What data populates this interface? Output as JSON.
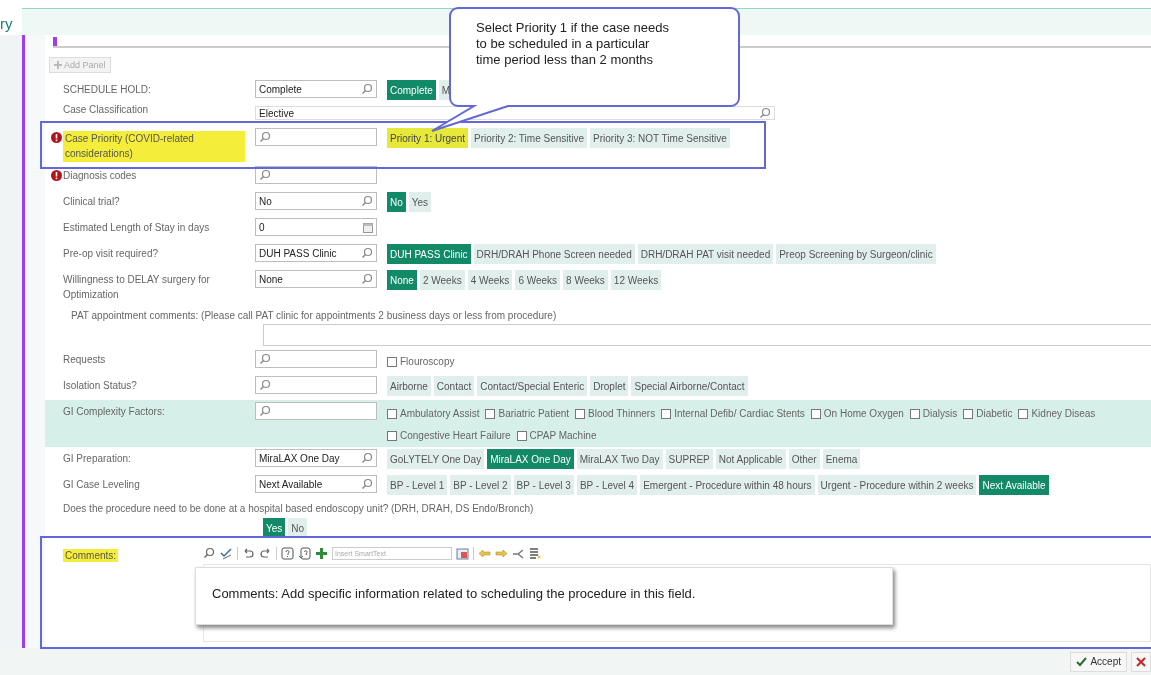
{
  "header": {
    "title": "ry"
  },
  "add_panel": {
    "label": "Add Panel",
    "disabled": true
  },
  "form_rows": [
    {
      "kind": "choice",
      "label": "SCHEDULE HOLD:",
      "value": "Complete",
      "options": [
        {
          "label": "Complete",
          "selected": true
        },
        {
          "label": "M",
          "selected": false
        }
      ]
    },
    {
      "kind": "text",
      "label": "Case Classification",
      "value": "Elective"
    },
    {
      "kind": "choice",
      "label": "Case Priority (COVID-related considerations)",
      "required": true,
      "highlighted": true,
      "value": "",
      "options": [
        {
          "label": "Priority 1: Urgent",
          "selected": false,
          "highlighted": true
        },
        {
          "label": "Priority 2: Time Sensitive",
          "selected": false,
          "highlighted": false
        },
        {
          "label": "Priority 3: NOT Time Sensitive",
          "selected": false,
          "highlighted": false
        }
      ]
    },
    {
      "kind": "choice",
      "label": "Diagnosis codes",
      "required": true,
      "value": "",
      "options": []
    },
    {
      "kind": "choice",
      "label": "Clinical trial?",
      "value": "No",
      "options": [
        {
          "label": "No",
          "selected": true
        },
        {
          "label": "Yes",
          "selected": false
        }
      ]
    },
    {
      "kind": "number",
      "label": "Estimated Length of Stay in days",
      "value": "0"
    },
    {
      "kind": "choice",
      "label": "Pre-op visit required?",
      "value": "DUH PASS Clinic",
      "options": [
        {
          "label": "DUH PASS Clinic",
          "selected": true
        },
        {
          "label": "DRH/DRAH Phone Screen needed",
          "selected": false
        },
        {
          "label": "DRH/DRAH PAT visit needed",
          "selected": false
        },
        {
          "label": "Preop Screening by Surgeon/clinic",
          "selected": false
        }
      ]
    },
    {
      "kind": "choice",
      "label": "Willingness to DELAY surgery for Optimization",
      "value": "None",
      "options": [
        {
          "label": "None",
          "selected": true
        },
        {
          "label": "2 Weeks",
          "selected": false
        },
        {
          "label": "4 Weeks",
          "selected": false
        },
        {
          "label": "6 Weeks",
          "selected": false
        },
        {
          "label": "8 Weeks",
          "selected": false
        },
        {
          "label": "12 Weeks",
          "selected": false
        }
      ]
    },
    {
      "kind": "note",
      "label": "PAT appointment comments: (Please call PAT clinic for appointments 2 business days or less from procedure)"
    },
    {
      "kind": "checks",
      "label": "Requests",
      "value": "",
      "options": [
        {
          "label": "Flouroscopy",
          "checked": false
        }
      ]
    },
    {
      "kind": "choice",
      "label": "Isolation Status?",
      "value": "",
      "options": [
        {
          "label": "Airborne",
          "selected": false
        },
        {
          "label": "Contact",
          "selected": false
        },
        {
          "label": "Contact/Special Enteric",
          "selected": false
        },
        {
          "label": "Droplet",
          "selected": false
        },
        {
          "label": "Special Airborne/Contact",
          "selected": false
        }
      ]
    },
    {
      "kind": "checks",
      "label": "GI Complexity Factors:",
      "shaded": true,
      "value": "",
      "options": [
        {
          "label": "Ambulatory Assist",
          "checked": false
        },
        {
          "label": "Bariatric Patient",
          "checked": false
        },
        {
          "label": "Blood Thinners",
          "checked": false
        },
        {
          "label": "Internal Defib/ Cardiac Stents",
          "checked": false
        },
        {
          "label": "On Home Oxygen",
          "checked": false
        },
        {
          "label": "Dialysis",
          "checked": false
        },
        {
          "label": "Diabetic",
          "checked": false
        },
        {
          "label": "Kidney Diseas",
          "checked": false
        },
        {
          "label": "Congestive Heart Failure",
          "checked": false
        },
        {
          "label": "CPAP Machine",
          "checked": false
        }
      ]
    },
    {
      "kind": "choice",
      "label": "GI Preparation:",
      "value": "MiraLAX One Day",
      "options": [
        {
          "label": "GoLYTELY One Day",
          "selected": false
        },
        {
          "label": "MiraLAX One Day",
          "selected": true
        },
        {
          "label": "MiraLAX Two Day",
          "selected": false
        },
        {
          "label": "SUPREP",
          "selected": false
        },
        {
          "label": "Not Applicable",
          "selected": false
        },
        {
          "label": "Other",
          "selected": false
        },
        {
          "label": "Enema",
          "selected": false
        }
      ]
    },
    {
      "kind": "choice",
      "label": "GI Case Leveling",
      "value": "Next Available",
      "options": [
        {
          "label": "BP - Level 1",
          "selected": false
        },
        {
          "label": "BP - Level 2",
          "selected": false
        },
        {
          "label": "BP - Level 3",
          "selected": false
        },
        {
          "label": "BP - Level 4",
          "selected": false
        },
        {
          "label": "Emergent - Procedure within 48 hours",
          "selected": false
        },
        {
          "label": "Urgent - Procedure within 2 weeks",
          "selected": false
        },
        {
          "label": "Next Available",
          "selected": true
        }
      ]
    },
    {
      "kind": "question",
      "label": "Does the procedure need to be done at a  hospital based endoscopy unit? (DRH, DRAH, DS Endo/Bronch)",
      "options": [
        {
          "label": "Yes",
          "selected": true
        },
        {
          "label": "No",
          "selected": false
        }
      ]
    }
  ],
  "comments": {
    "label": "Comments:",
    "highlighted": true,
    "smarttext_placeholder": "Insert SmartText"
  },
  "actions": [
    {
      "kind": "accept",
      "label": "Accept"
    },
    {
      "kind": "cancel"
    }
  ],
  "callouts": [
    {
      "kind": "speech",
      "text": "Select Priority 1 if the case needs to be scheduled in a particular time period less than 2 months"
    },
    {
      "kind": "box",
      "text": "Comments: Add specific information related to scheduling the procedure in this field."
    }
  ]
}
